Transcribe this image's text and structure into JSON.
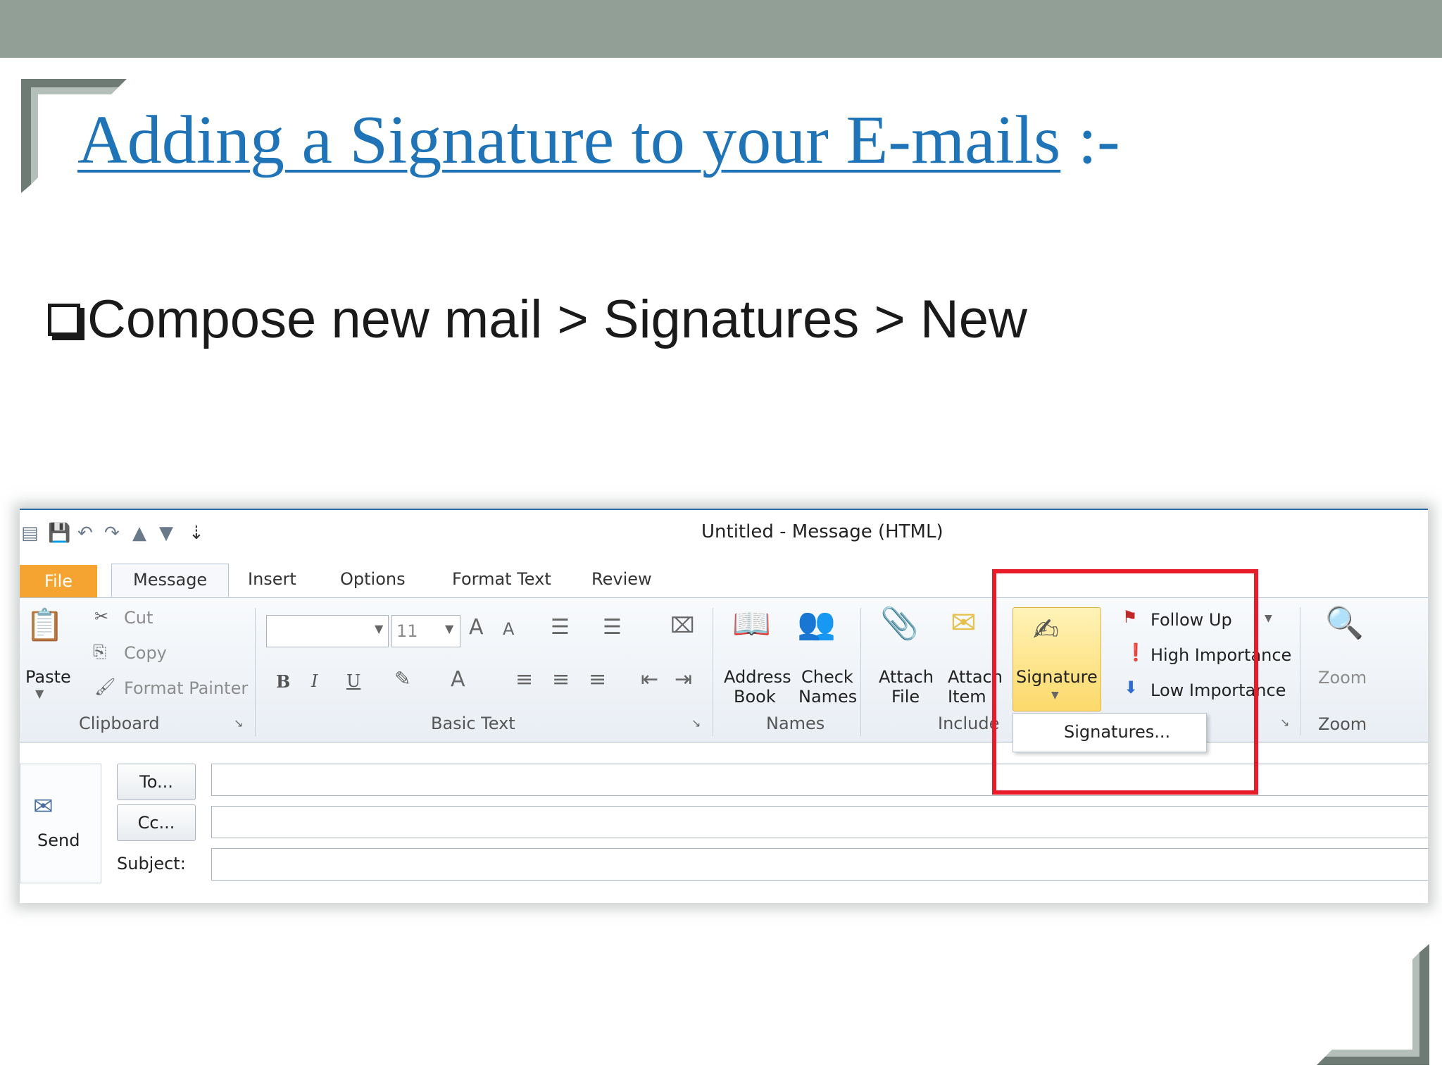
{
  "slide": {
    "title_link": "Adding a Signature to your E-mails",
    "title_suffix": ":-",
    "bullet": "Compose new mail > Signatures > New"
  },
  "window": {
    "title": "Untitled  -  Message (HTML)"
  },
  "tabs": {
    "file": "File",
    "message": "Message",
    "insert": "Insert",
    "options": "Options",
    "format_text": "Format Text",
    "review": "Review"
  },
  "clipboard": {
    "paste": "Paste",
    "cut": "Cut",
    "copy": "Copy",
    "format_painter": "Format Painter",
    "label": "Clipboard"
  },
  "basic_text": {
    "font_size": "11",
    "label": "Basic Text",
    "bold": "B",
    "italic": "I",
    "underline": "U"
  },
  "names": {
    "address_book_1": "Address",
    "address_book_2": "Book",
    "check_names_1": "Check",
    "check_names_2": "Names",
    "label": "Names"
  },
  "include": {
    "attach_file_1": "Attach",
    "attach_file_2": "File",
    "attach_item_1": "Attach",
    "attach_item_2": "Item",
    "signature": "Signature",
    "label": "Include",
    "signatures_menu": "Signatures..."
  },
  "tags": {
    "follow_up": "Follow Up",
    "high_importance": "High Importance",
    "low_importance": "Low Importance"
  },
  "zoom": {
    "button": "Zoom",
    "label": "Zoom"
  },
  "compose": {
    "send": "Send",
    "to": "To...",
    "cc": "Cc...",
    "subject": "Subject:"
  },
  "colors": {
    "title": "#1f73b7",
    "topbar": "#919f97",
    "file_tab": "#f5a431",
    "highlight": "#e81b2b"
  }
}
